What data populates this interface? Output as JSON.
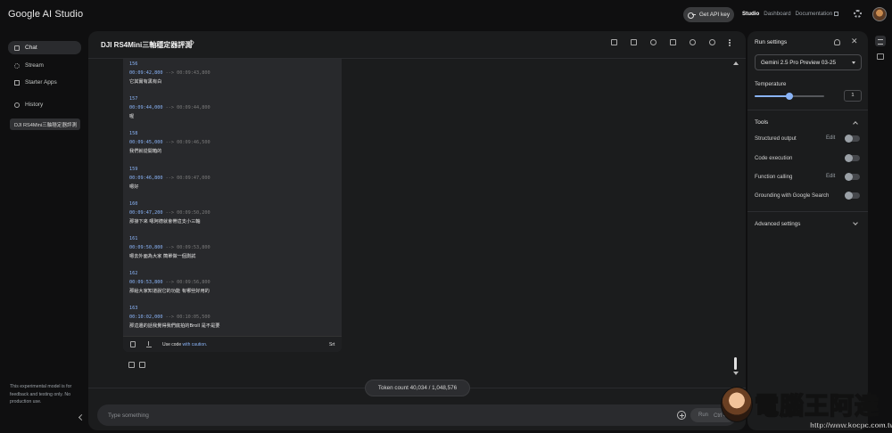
{
  "app": {
    "title": "Google AI Studio",
    "get_api_key": "Get API key",
    "nav": [
      {
        "label": "Studio",
        "active": true
      },
      {
        "label": "Dashboard",
        "active": false
      },
      {
        "label": "Documentation",
        "active": false
      }
    ]
  },
  "sidebar": {
    "items": [
      {
        "label": "Chat",
        "icon": "chat-icon",
        "active": true
      },
      {
        "label": "Stream",
        "icon": "stream-icon",
        "active": false
      },
      {
        "label": "Starter Apps",
        "icon": "starter-apps-icon",
        "active": false
      }
    ],
    "history_label": "History",
    "history_entries": [
      "DJI RS4Mini三軸穩定器評測"
    ],
    "note": "This experimental model is for feedback and testing only. No production use."
  },
  "chat": {
    "title": "DJI RS4Mini三軸穩定器評測",
    "srt_entries": [
      {
        "index": "156",
        "start": "00:09:42,800",
        "arrow": "-->",
        "end": "00:09:43,800",
        "text": "它其實有黑有白"
      },
      {
        "index": "157",
        "start": "00:09:44,000",
        "arrow": "-->",
        "end": "00:09:44,800",
        "text": "喔"
      },
      {
        "index": "158",
        "start": "00:09:45,000",
        "arrow": "-->",
        "end": "00:09:46,500",
        "text": "我們就從開箱的"
      },
      {
        "index": "159",
        "start": "00:09:46,800",
        "arrow": "-->",
        "end": "00:09:47,000",
        "text": "嗯好"
      },
      {
        "index": "160",
        "start": "00:09:47,200",
        "arrow": "-->",
        "end": "00:09:50,200",
        "text": "那接下來 嗯阿德就會帶這支小三軸"
      },
      {
        "index": "161",
        "start": "00:09:50,800",
        "arrow": "-->",
        "end": "00:09:53,800",
        "text": "嗯去外面為大家 簡單做一個測試"
      },
      {
        "index": "162",
        "start": "00:09:53,800",
        "arrow": "-->",
        "end": "00:09:56,800",
        "text": "那給大家知道說它的功能 有哪些好用的"
      },
      {
        "index": "163",
        "start": "00:10:02,000",
        "arrow": "-->",
        "end": "00:10:05,500",
        "text": "那這邊的話我覺得我們底拍的Broll 是不是要"
      }
    ],
    "code_footer": {
      "caution_prefix": "Use code ",
      "caution_link": "with caution.",
      "language": "Srt"
    },
    "token_count": "Token count 40,034 / 1,048,576",
    "input_placeholder": "Type something",
    "run_label": "Run",
    "run_shortcut": "Ctrl ↵"
  },
  "run_settings": {
    "title": "Run settings",
    "model": "Gemini 2.5 Pro Preview 03-25",
    "temperature_label": "Temperature",
    "temperature_value": "1",
    "temperature_fraction": 0.5,
    "tools_label": "Tools",
    "tools": [
      {
        "label": "Structured output",
        "edit": "Edit",
        "enabled": false
      },
      {
        "label": "Code execution",
        "edit": "",
        "enabled": false
      },
      {
        "label": "Function calling",
        "edit": "Edit",
        "enabled": false
      },
      {
        "label": "Grounding with Google Search",
        "edit": "",
        "enabled": false
      }
    ],
    "advanced_label": "Advanced settings"
  },
  "watermark": {
    "brand": "電腦王阿達",
    "url": "http://www.kocpc.com.tw"
  },
  "colors": {
    "accent": "#8ab4f8",
    "background": "#0f0f10",
    "panel": "#1b1c1d"
  }
}
